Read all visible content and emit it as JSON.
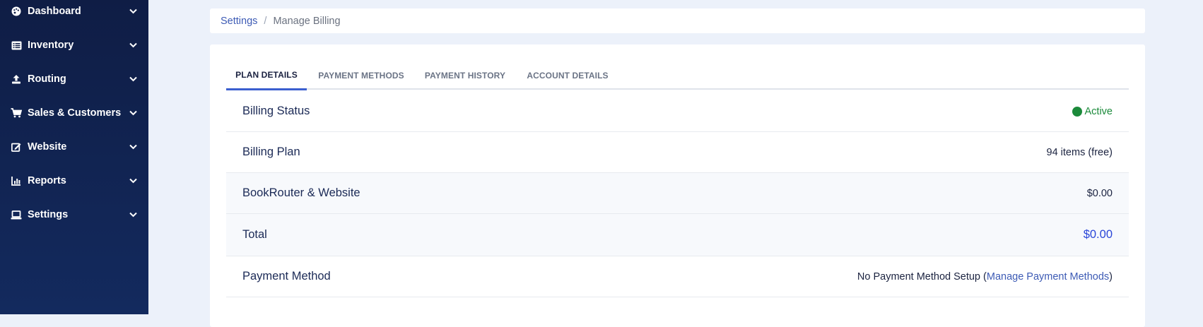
{
  "sidebar": {
    "items": [
      {
        "label": "Dashboard",
        "icon": "palette-icon"
      },
      {
        "label": "Inventory",
        "icon": "list-icon"
      },
      {
        "label": "Routing",
        "icon": "upload-icon"
      },
      {
        "label": "Sales & Customers",
        "icon": "cart-icon"
      },
      {
        "label": "Website",
        "icon": "edit-icon"
      },
      {
        "label": "Reports",
        "icon": "chart-icon"
      },
      {
        "label": "Settings",
        "icon": "laptop-icon"
      }
    ]
  },
  "breadcrumb": {
    "parent": "Settings",
    "separator": "/",
    "current": "Manage Billing"
  },
  "tabs": [
    {
      "label": "PLAN DETAILS",
      "active": true
    },
    {
      "label": "PAYMENT METHODS",
      "active": false
    },
    {
      "label": "PAYMENT HISTORY",
      "active": false
    },
    {
      "label": "ACCOUNT DETAILS",
      "active": false
    }
  ],
  "plan": {
    "billing_status": {
      "label": "Billing Status",
      "value": "Active"
    },
    "billing_plan": {
      "label": "Billing Plan",
      "value": "94 items (free)"
    },
    "bookrouter": {
      "label": "BookRouter & Website",
      "value": "$0.00"
    },
    "total": {
      "label": "Total",
      "value": "$0.00"
    },
    "payment_method": {
      "label": "Payment Method",
      "value_prefix": "No Payment Method Setup (",
      "link": "Manage Payment Methods",
      "value_suffix": ")"
    }
  },
  "colors": {
    "sidebar_bg": "#0f1d45",
    "accent": "#3b5fcf",
    "status_active": "#1b8a3a",
    "total": "#2a46d8"
  }
}
